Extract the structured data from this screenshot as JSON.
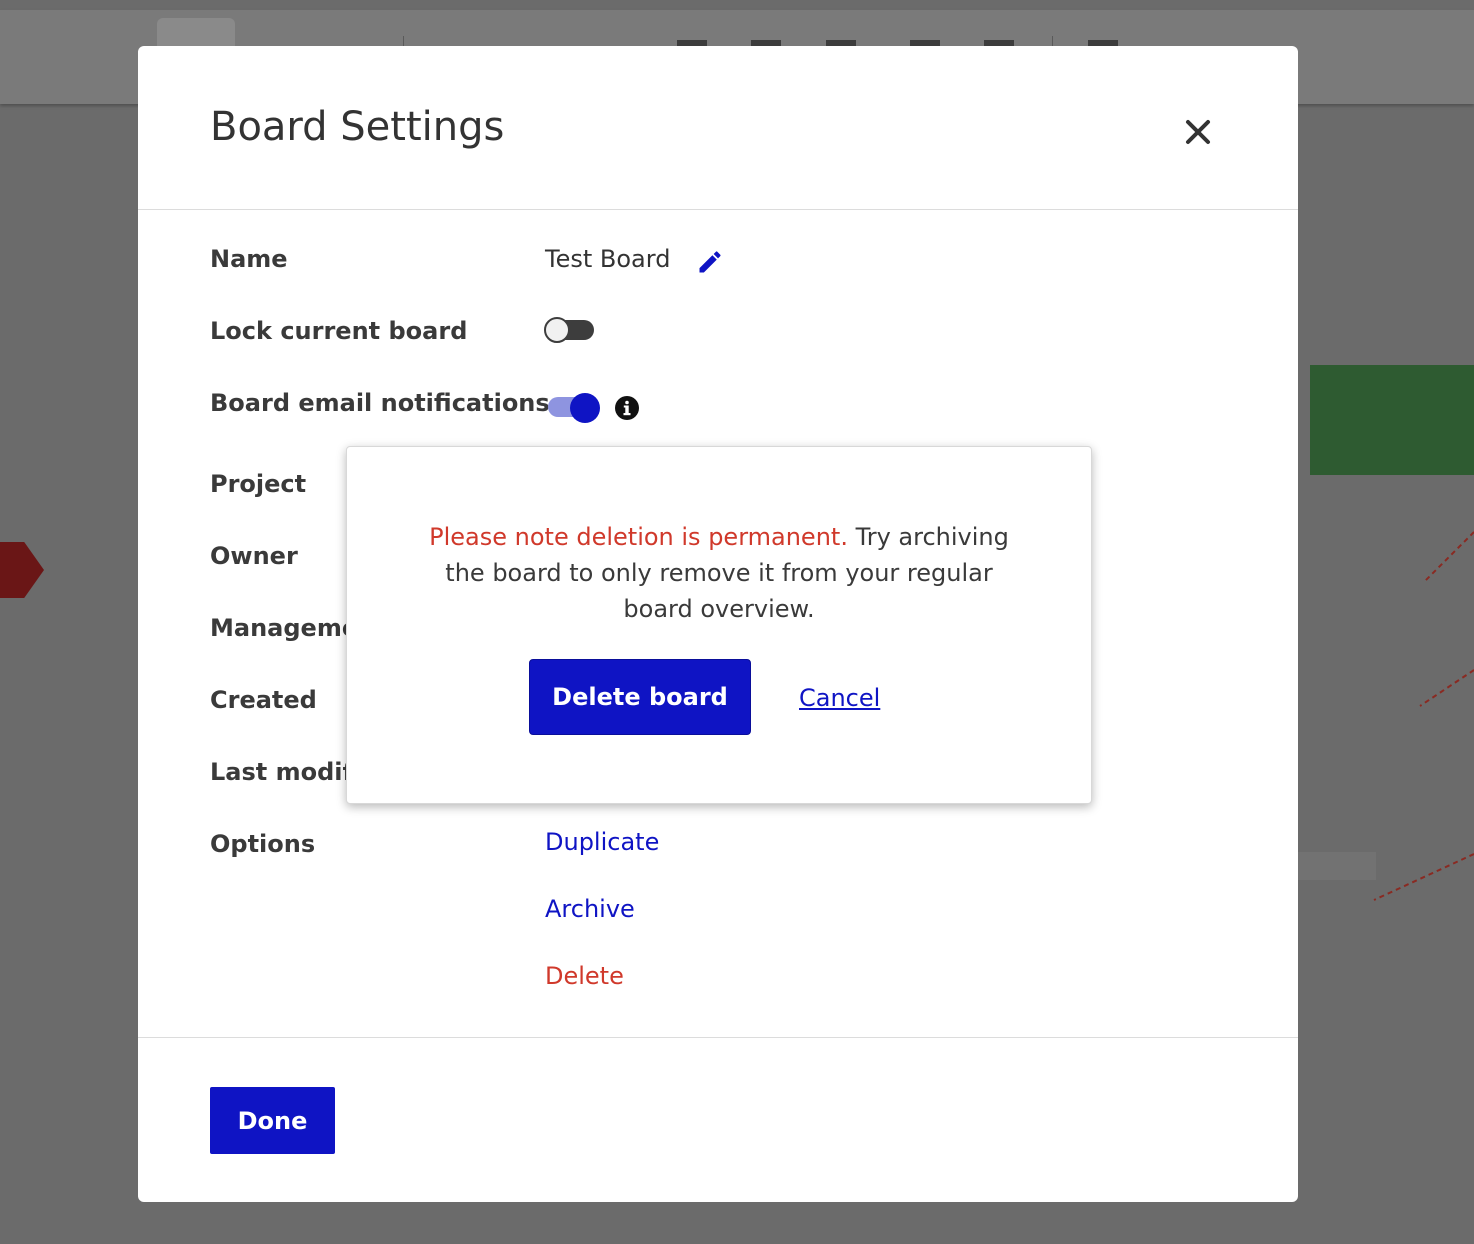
{
  "dialog": {
    "title": "Board Settings",
    "close_icon": "close-icon"
  },
  "settings": {
    "name_label": "Name",
    "name_value": "Test Board",
    "lock_label": "Lock current board",
    "lock_enabled": false,
    "email_label": "Board email notifications",
    "email_enabled": true,
    "project_label": "Project",
    "owner_label": "Owner",
    "management_label": "Manageme",
    "created_label": "Created",
    "last_modified_label": "Last modifi",
    "options_label": "Options"
  },
  "options": {
    "duplicate": "Duplicate",
    "archive": "Archive",
    "delete": "Delete"
  },
  "footer": {
    "done_label": "Done"
  },
  "confirm": {
    "warning": "Please note deletion is permanent.",
    "message": " Try archiving the board to only remove it from your regular board overview.",
    "delete_label": "Delete board",
    "cancel_label": "Cancel"
  },
  "colors": {
    "accent": "#0f14c4",
    "danger": "#d0392b",
    "toggle_on_track": "#8e94e0"
  }
}
